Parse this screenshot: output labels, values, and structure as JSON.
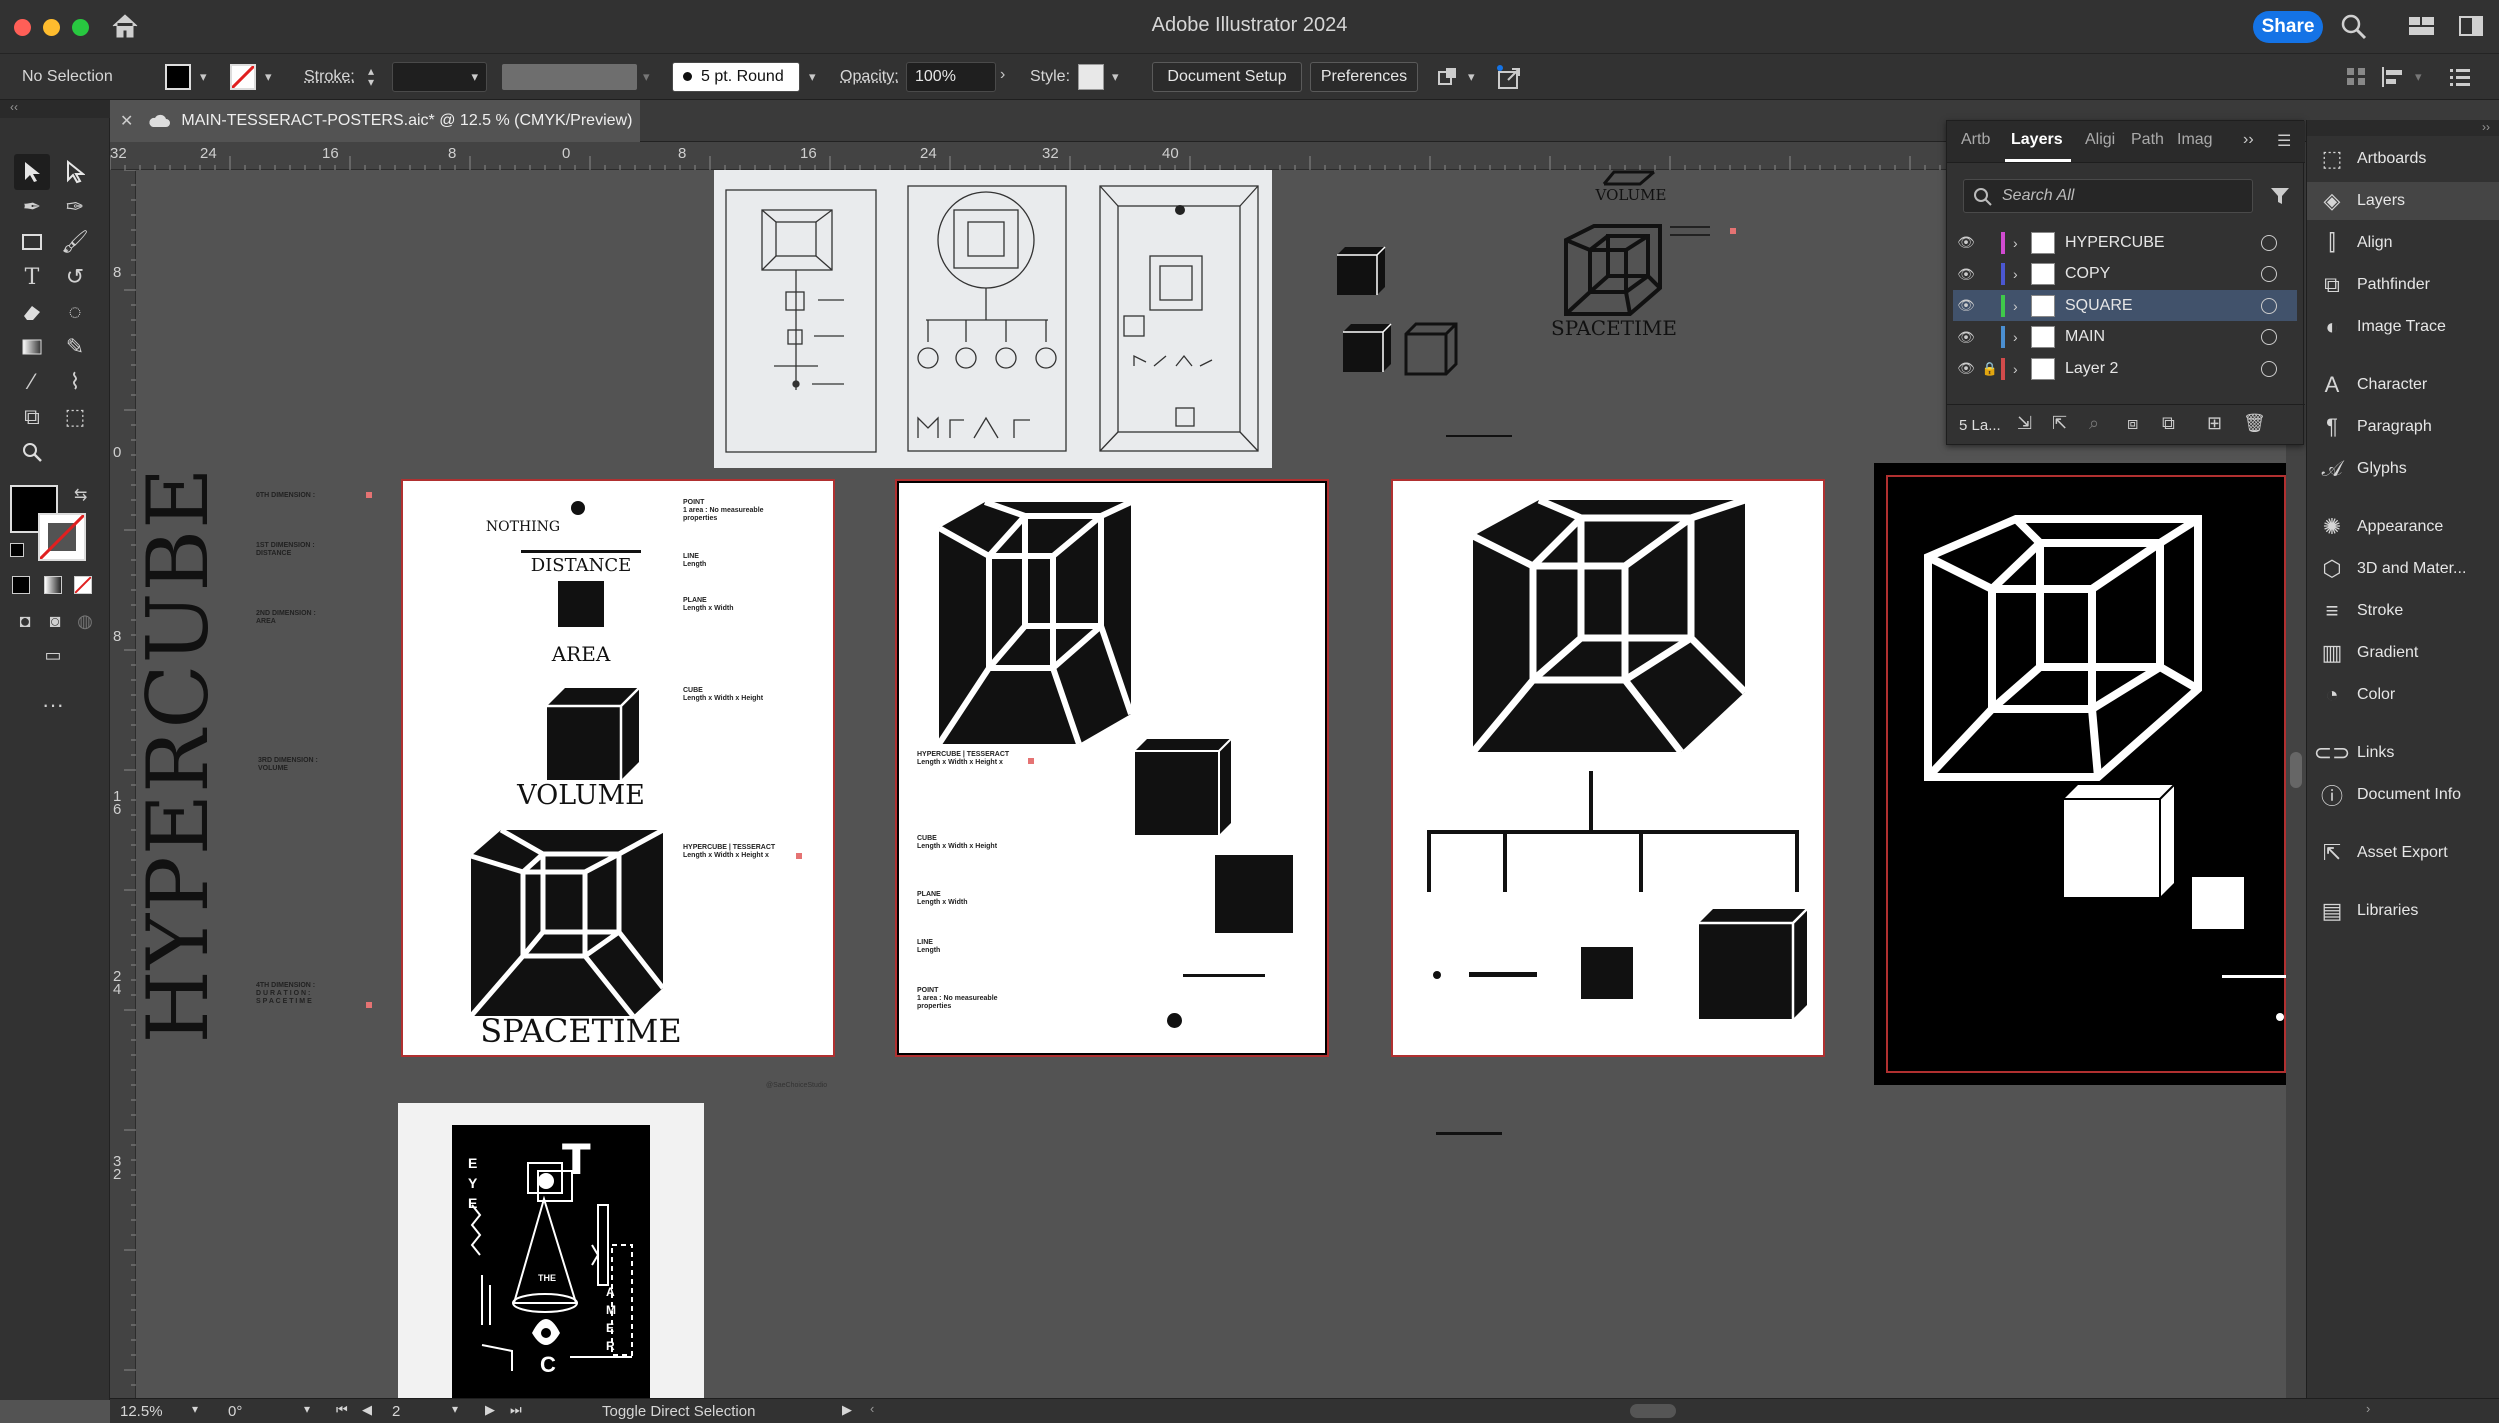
{
  "window": {
    "app_title": "Adobe Illustrator 2024",
    "share_label": "Share",
    "traffic_colors": [
      "#ff5f57",
      "#febc2e",
      "#28c840"
    ]
  },
  "controlbar": {
    "selection": "No Selection",
    "stroke_label": "Stroke:",
    "brush": "5 pt. Round",
    "opacity_label": "Opacity:",
    "opacity_value": "100%",
    "style_label": "Style:",
    "document_setup": "Document Setup",
    "preferences": "Preferences"
  },
  "document": {
    "tab_title": "MAIN-TESSERACT-POSTERS.aic* @ 12.5 % (CMYK/Preview)"
  },
  "ruler": {
    "h_ticks": [
      "32",
      "24",
      "16",
      "8",
      "0",
      "8",
      "16",
      "24",
      "32",
      "40"
    ],
    "v_ticks": [
      "8",
      "0",
      "8",
      "1\n6",
      "2\n4",
      "3\n2"
    ]
  },
  "artwork": {
    "vertical_title": "HYPERCUBE",
    "side_labels": [
      "0TH DIMENSION :",
      "1ST DIMENSION :\nDISTANCE",
      "2ND DIMENSION :\nAREA",
      "3RD DIMENSION :\nVOLUME",
      "4TH DIMENSION :\nD U R A T I O N :\nS P A C E T I M E"
    ],
    "poster1": {
      "nothing": "NOTHING",
      "distance": "DISTANCE",
      "area": "AREA",
      "volume": "VOLUME",
      "spacetime": "SPACETIME",
      "notes": [
        "POINT\n1 area : No measureable\nproperties",
        "LINE\nLength",
        "PLANE\nLength x Width",
        "CUBE\nLength x Width x Height",
        "HYPERCUBE | TESSERACT\nLength x Width x Height x"
      ]
    },
    "poster2": {
      "notes": [
        "HYPERCUBE | TESSERACT\nLength x Width x Height x",
        "CUBE\nLength x Width x Height",
        "PLANE\nLength x Width",
        "LINE\nLength",
        "POINT\n1 area : No measureable\nproperties"
      ]
    },
    "top_volume": "VOLUME",
    "top_spacetime": "SPACETIME",
    "sketch_caption": "HYPERCUBE",
    "credit": "@SaeChoiceStudio",
    "poster5": {
      "big_letter": "T",
      "the": "THE",
      "letter_c": "C",
      "side_left": [
        "E",
        "Y",
        "E"
      ],
      "side_right": [
        "A",
        "M",
        "E",
        "R"
      ]
    }
  },
  "layers_panel": {
    "tabs": [
      "Artb",
      "Layers",
      "Aligi",
      "Path",
      "Imag"
    ],
    "active_tab": "Layers",
    "search_placeholder": "Search All",
    "layers": [
      {
        "name": "HYPERCUBE",
        "color": "#d14bd1",
        "visible": true,
        "locked": false,
        "selected": false
      },
      {
        "name": "COPY",
        "color": "#4b57d1",
        "visible": true,
        "locked": false,
        "selected": false
      },
      {
        "name": "SQUARE",
        "color": "#3fc94a",
        "visible": true,
        "locked": false,
        "selected": true
      },
      {
        "name": "MAIN",
        "color": "#4b8fd1",
        "visible": true,
        "locked": false,
        "selected": false
      },
      {
        "name": "Layer 2",
        "color": "#d14b4b",
        "visible": true,
        "locked": true,
        "selected": false
      }
    ],
    "footer_count": "5 La..."
  },
  "dock": {
    "groups": [
      [
        {
          "label": "Artboards",
          "icon": "artboards-icon"
        },
        {
          "label": "Layers",
          "icon": "layers-icon",
          "active": true
        },
        {
          "label": "Align",
          "icon": "align-icon"
        },
        {
          "label": "Pathfinder",
          "icon": "pathfinder-icon"
        },
        {
          "label": "Image Trace",
          "icon": "image-trace-icon"
        }
      ],
      [
        {
          "label": "Character",
          "icon": "character-icon"
        },
        {
          "label": "Paragraph",
          "icon": "paragraph-icon"
        },
        {
          "label": "Glyphs",
          "icon": "glyphs-icon"
        }
      ],
      [
        {
          "label": "Appearance",
          "icon": "appearance-icon"
        },
        {
          "label": "3D and Mater...",
          "icon": "3d-materials-icon"
        },
        {
          "label": "Stroke",
          "icon": "stroke-icon"
        },
        {
          "label": "Gradient",
          "icon": "gradient-icon"
        },
        {
          "label": "Color",
          "icon": "color-icon"
        }
      ],
      [
        {
          "label": "Links",
          "icon": "links-icon"
        },
        {
          "label": "Document Info",
          "icon": "document-info-icon"
        }
      ],
      [
        {
          "label": "Asset Export",
          "icon": "asset-export-icon"
        }
      ],
      [
        {
          "label": "Libraries",
          "icon": "libraries-icon"
        }
      ]
    ]
  },
  "statusbar": {
    "zoom": "12.5%",
    "rotation": "0°",
    "artboard_number": "2",
    "tool_hint": "Toggle Direct Selection"
  }
}
